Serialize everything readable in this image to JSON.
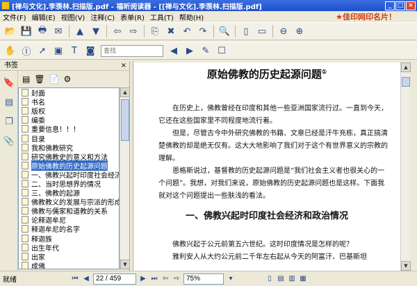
{
  "window": {
    "title": "[禅与文化].李羡林.扫描版.pdf - 福昕阅读器 - [[禅与文化].李羡林.扫描版.pdf]"
  },
  "menu": {
    "items": [
      "文件(F)",
      "编辑(E)",
      "视图(V)",
      "注释(C)",
      "表单(R)",
      "工具(T)",
      "帮助(H)"
    ],
    "banner": "★佳印网印名片！"
  },
  "toolbar": {
    "search_placeholder": "查找"
  },
  "bookmarks": {
    "title": "书签",
    "items": [
      {
        "label": "封面"
      },
      {
        "label": "书名"
      },
      {
        "label": "版权"
      },
      {
        "label": "编委"
      },
      {
        "label": "重要信息！！！"
      },
      {
        "label": "目录"
      },
      {
        "label": "我和佛教研究"
      },
      {
        "label": "研究佛教史的意义和方法"
      },
      {
        "label": "原始佛教的历史起源问题"
      },
      {
        "label": "一、佛教兴起时印度社会经济"
      },
      {
        "label": "二、当时思想界的情况"
      },
      {
        "label": "三、佛教的起源"
      },
      {
        "label": "佛教教义的发展与宗派的形成"
      },
      {
        "label": "佛教与儒家和道教的关系"
      },
      {
        "label": "论释迦牟尼"
      },
      {
        "label": "释迦牟尼的名字"
      },
      {
        "label": "释迦族"
      },
      {
        "label": "出生年代"
      },
      {
        "label": "出家"
      },
      {
        "label": "成佛"
      },
      {
        "label": "传教"
      }
    ],
    "selected_index": 8
  },
  "document": {
    "title": "原始佛教的历史起源问题",
    "footnote_mark": "①",
    "paragraphs": [
      "在历史上，佛教曾经在印度和其他一些亚洲国家流行过。一直到今天，它还在这些国家里不同程度地流行着。",
      "但是，尽管古今中外研究佛教的书籍、文章已经是汗牛充栋，真正搞清楚佛教的却是绝无仅有。这大大地影响了我们对于这个有世界意义的宗教的理解。",
      "恩格斯说过，基督教的历史起源问题是“我们社会主义者也很关心的一个问题”。我想，对我们来说，原始佛教的历史起源问题也是这样。下面我就对这个问题提出一些肤浅的看法。"
    ],
    "heading": "一、佛教兴起时印度社会经济和政治情况",
    "para2": [
      "佛教兴起于公元前第五六世纪。这时印度情况是怎样的呢？",
      "雅利安人从大约公元前二千年左右起从今天的阿富汗、巴基斯坦"
    ]
  },
  "status": {
    "ready": "就绪",
    "page": "22 / 459",
    "zoom": "75%"
  }
}
